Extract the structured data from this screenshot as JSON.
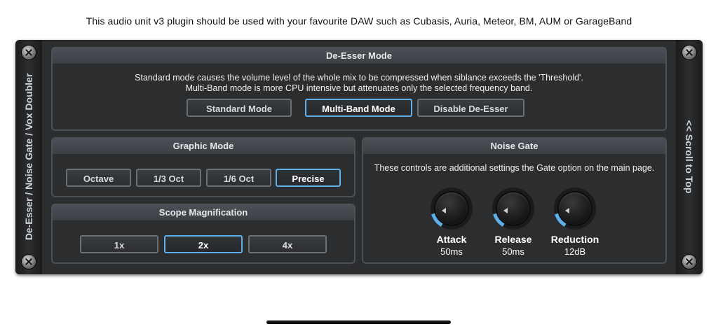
{
  "caption": "This audio unit v3 plugin should be used with your favourite DAW such as Cubasis, Auria, Meteor, BM, AUM or GarageBand",
  "side_left": {
    "label": "De-Esser / Noise Gate / Vox Doubler"
  },
  "side_right": {
    "label": "<< Scroll to Top"
  },
  "deesser": {
    "title": "De-Esser Mode",
    "desc_line1": "Standard mode causes the volume level of the whole mix to be compressed when siblance exceeds the 'Threshold'.",
    "desc_line2": "Multi-Band mode is more CPU intensive but attenuates only the selected frequency band.",
    "buttons": [
      "Standard Mode",
      "Multi-Band Mode",
      "Disable De-Esser"
    ],
    "selected": "Multi-Band Mode"
  },
  "graphic": {
    "title": "Graphic Mode",
    "buttons": [
      "Octave",
      "1/3 Oct",
      "1/6 Oct",
      "Precise"
    ],
    "selected": "Precise"
  },
  "scope": {
    "title": "Scope Magnification",
    "buttons": [
      "1x",
      "2x",
      "4x"
    ],
    "selected": "2x"
  },
  "noise_gate": {
    "title": "Noise Gate",
    "desc": "These controls are additional settings the Gate option on the main page.",
    "knobs": [
      {
        "label": "Attack",
        "value": "50ms",
        "level": 0.08
      },
      {
        "label": "Release",
        "value": "50ms",
        "level": 0.08
      },
      {
        "label": "Reduction",
        "value": "12dB",
        "level": 0.08
      }
    ]
  },
  "colors": {
    "accent": "#5fb0ea",
    "panel_border": "#4c5157"
  }
}
